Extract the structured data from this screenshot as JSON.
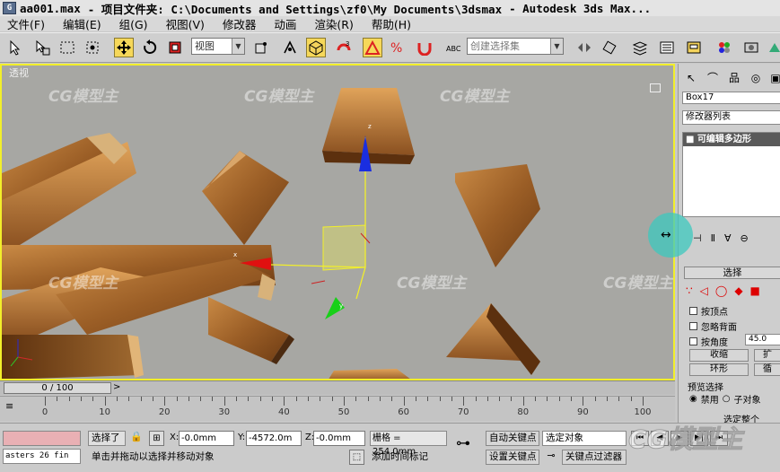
{
  "window": {
    "icon": "3ds-max-icon",
    "file_name": "aa001.max",
    "project_prefix": "- 项目文件夹: C:\\Documents and Settings\\zf0\\My Documents\\3dsmax",
    "app_name": "- Autodesk 3ds Max..."
  },
  "menu": {
    "items": [
      "文件(F)",
      "编辑(E)",
      "组(G)",
      "视图(V)",
      "修改器",
      "动画",
      "渲染(R)",
      "帮助(H)"
    ]
  },
  "toolbar": {
    "view_combo": "视图",
    "selection_set_placeholder": "创建选择集",
    "active_tool": "move"
  },
  "viewport": {
    "label": "透视",
    "watermark": "CG模型主",
    "border_color": "#f2ef2a"
  },
  "command_panel": {
    "object_name": "Box17",
    "modifier_list_label": "修改器列表",
    "stack_item": "可编辑多边形",
    "rollout_title": "选择",
    "checkbox_vertex": "按顶点",
    "checkbox_backface": "忽略背面",
    "checkbox_angle": "按角度",
    "angle_value": "45.0",
    "btn_shrink": "收缩",
    "btn_grow_partial": "扩",
    "btn_ring": "环形",
    "btn_loop_partial": "循",
    "preview_label": "预览选择",
    "radio_disabled": "禁用",
    "radio_subobject": "子对象",
    "partial_text": "选定整个"
  },
  "timeline": {
    "position": "0 / 100",
    "tick_labels": [
      "0",
      "10",
      "20",
      "30",
      "40",
      "50",
      "60",
      "70",
      "80",
      "90",
      "100"
    ]
  },
  "status": {
    "maxscript_text": "asters 26 fin",
    "selection_text": "选择了",
    "x_label": "X:",
    "x_value": "-0.0mm",
    "y_label": "Y:",
    "y_value": "-4572.0m",
    "z_label": "Z:",
    "z_value": "-0.0mm",
    "grid_text": "栅格 = 254.0mm",
    "prompt_text": "单击并拖动以选择并移动对象",
    "add_time_tag": "添加时间标记",
    "auto_key": "自动关键点",
    "selected_object": "选定对象",
    "set_key": "设置关键点",
    "key_filters": "关键点过滤器"
  },
  "colors": {
    "viewport_bg": "#a7a7a3",
    "active_tool": "#f6d85a",
    "wood": "#a86a2c"
  }
}
